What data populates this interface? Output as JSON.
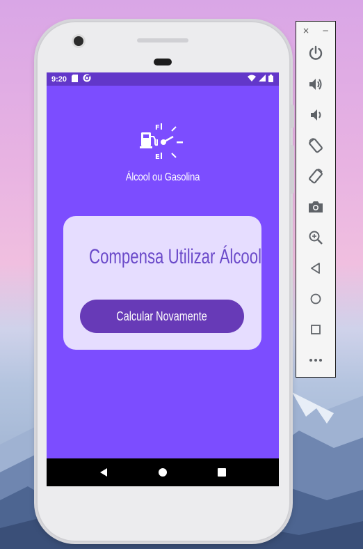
{
  "status_bar": {
    "time": "9:20"
  },
  "app": {
    "title": "Álcool ou Gasolina",
    "result_text": "Compensa Utilizar Álcool",
    "recalculate_button": "Calcular Novamente"
  },
  "colors": {
    "screen_bg": "#7c4dff",
    "status_bar_bg": "#6237c9",
    "card_bg": "#e6ddff",
    "button_bg": "#673ab7",
    "result_text": "#6a49c9"
  },
  "emulator_toolbar": {
    "close": "×",
    "minimize": "−",
    "icons": [
      "power-icon",
      "volume-up-icon",
      "volume-down-icon",
      "rotate-left-icon",
      "rotate-right-icon",
      "screenshot-icon",
      "zoom-icon",
      "back-icon",
      "home-icon",
      "overview-icon",
      "more-icon"
    ]
  }
}
